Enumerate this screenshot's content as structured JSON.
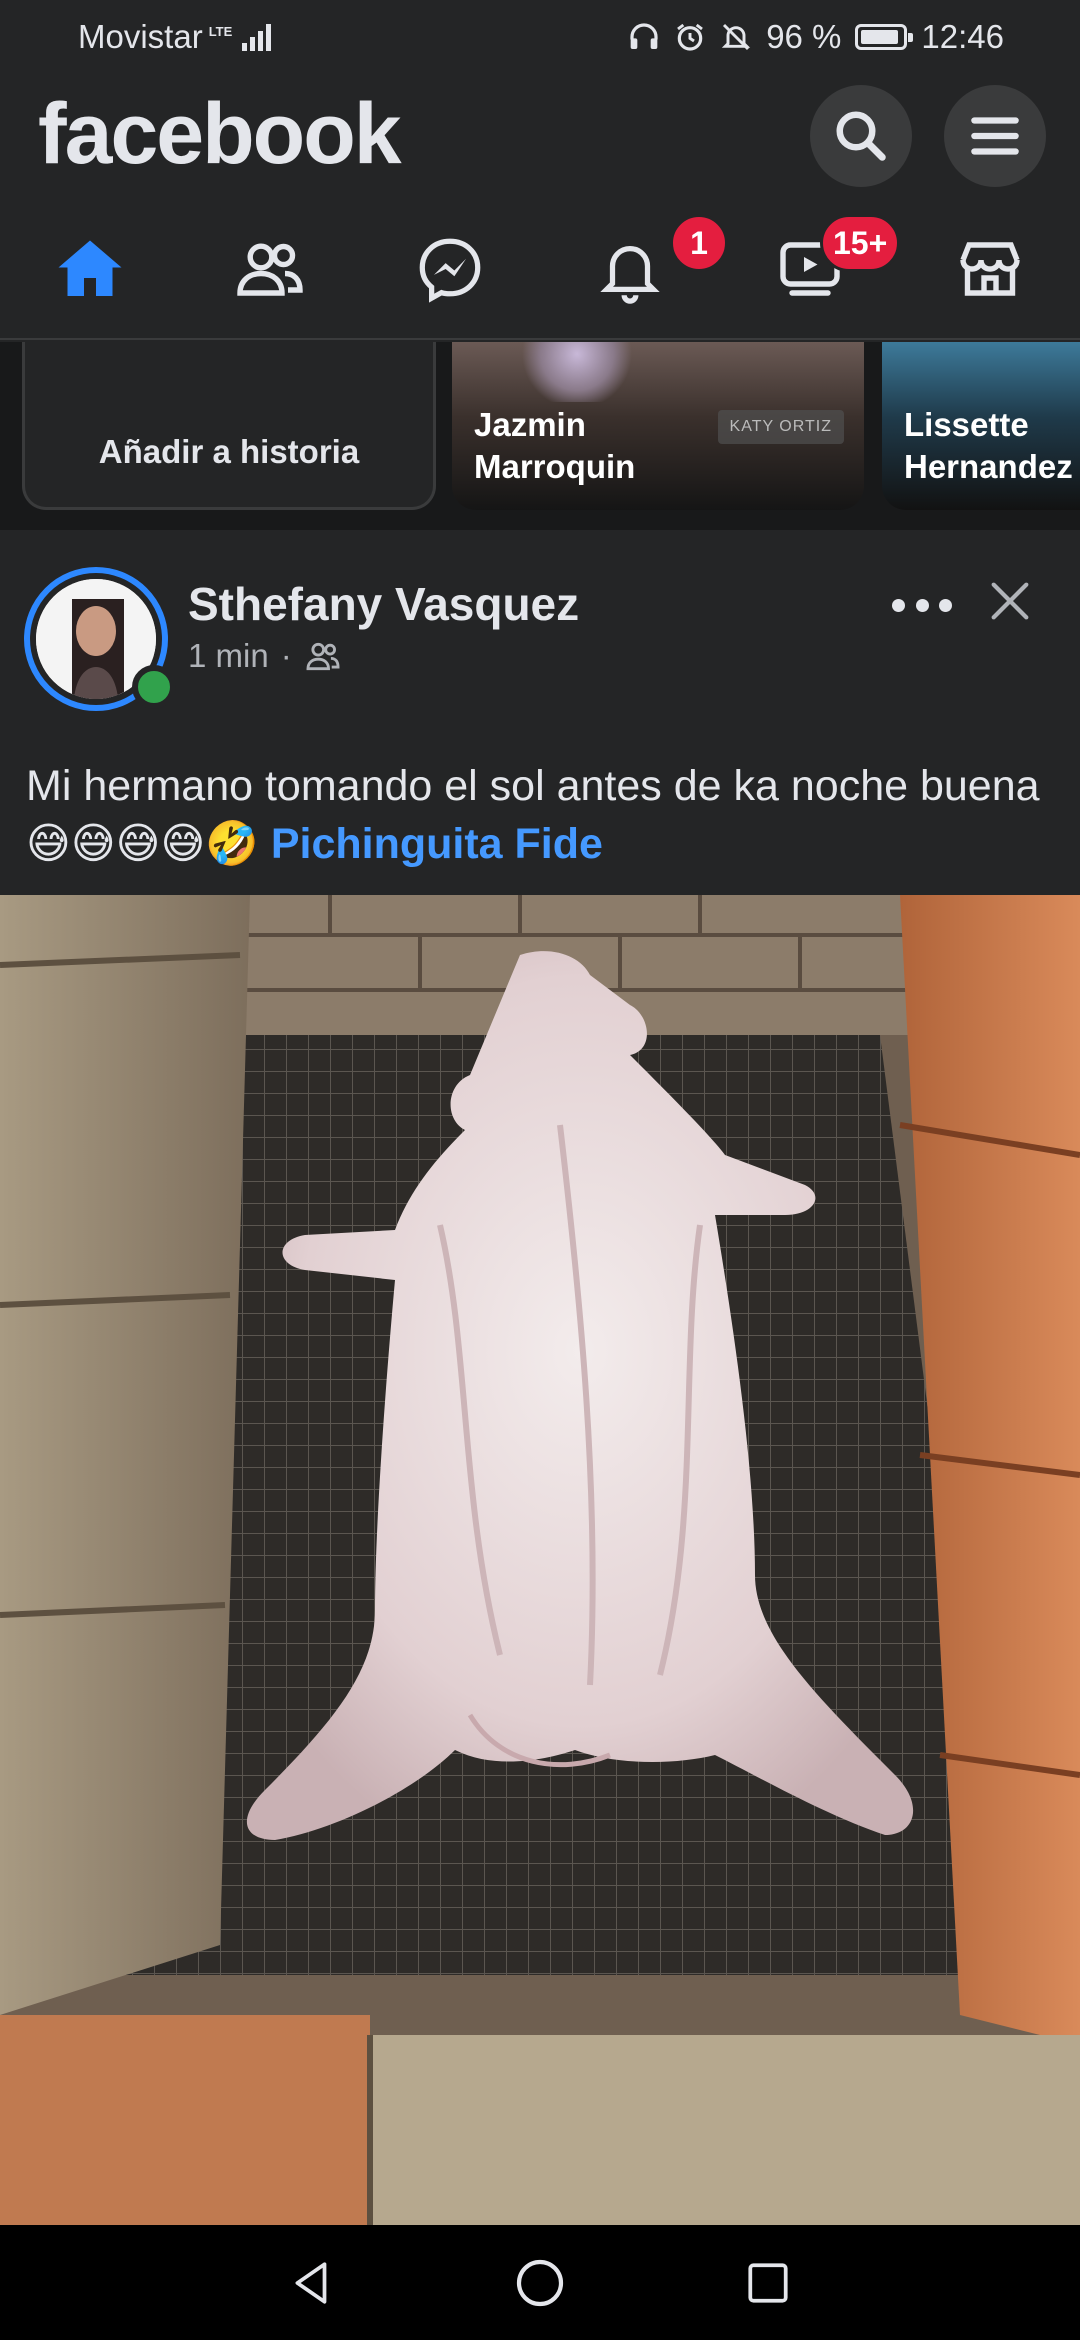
{
  "status_bar": {
    "carrier": "Movistar",
    "network": "LTE",
    "battery": "96 %",
    "time": "12:46"
  },
  "header": {
    "logo": "facebook",
    "search_icon": "search-icon",
    "menu_icon": "hamburger-menu-icon"
  },
  "nav": {
    "items": [
      {
        "name": "home",
        "icon": "home-icon",
        "badge": ""
      },
      {
        "name": "friends",
        "icon": "friends-icon",
        "badge": ""
      },
      {
        "name": "messenger",
        "icon": "messenger-icon",
        "badge": ""
      },
      {
        "name": "notifications",
        "icon": "bell-icon",
        "badge": "1"
      },
      {
        "name": "watch",
        "icon": "video-icon",
        "badge": "15+"
      },
      {
        "name": "marketplace",
        "icon": "store-icon",
        "badge": ""
      }
    ],
    "active_color": "#2d88ff"
  },
  "stories": {
    "add_label": "Añadir a historia",
    "items": [
      {
        "name": "Jazmin\nMarroquin",
        "name_line1": "Jazmin",
        "name_line2": "Marroquin",
        "watermark": "KATY ORTIZ"
      },
      {
        "name_line1": "Lissette",
        "name_line2": "Hernandez"
      }
    ]
  },
  "post": {
    "author": "Sthefany Vasquez",
    "time": "1 min",
    "separator": "·",
    "audience_icon": "friends-audience-icon",
    "text": "Mi hermano tomando el sol antes de ka noche buena",
    "emojis": "😅😅😅😅🤣",
    "tag": "Pichinguita Fide",
    "online_color": "#31a24c",
    "tag_color": "#4599ff"
  },
  "android_nav": {
    "back": "back-triangle-icon",
    "home": "home-circle-icon",
    "recents": "recents-square-icon"
  }
}
